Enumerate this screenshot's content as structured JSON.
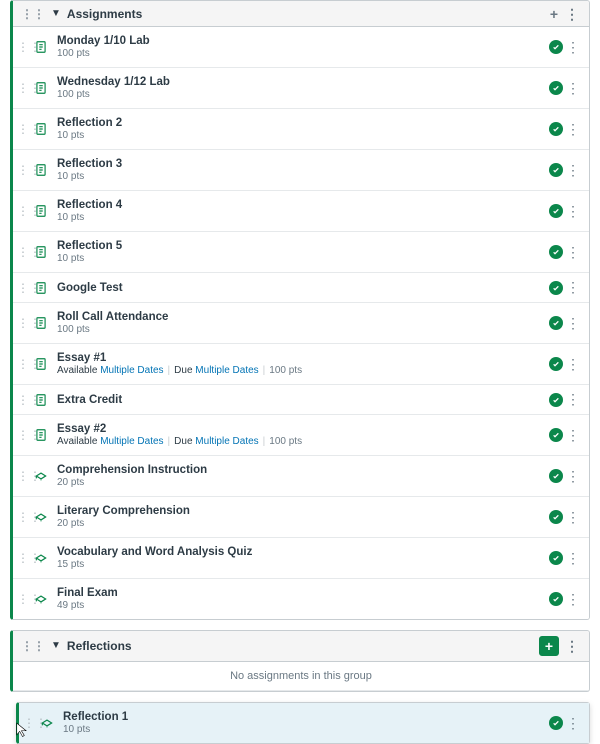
{
  "groups": [
    {
      "title": "Assignments",
      "plus_style": "plain",
      "items": [
        {
          "icon": "assignment",
          "name": "Monday 1/10 Lab",
          "points_text": "100 pts"
        },
        {
          "icon": "assignment",
          "name": "Wednesday 1/12 Lab",
          "points_text": "100 pts"
        },
        {
          "icon": "assignment",
          "name": "Reflection 2",
          "points_text": "10 pts"
        },
        {
          "icon": "assignment",
          "name": "Reflection 3",
          "points_text": "10 pts"
        },
        {
          "icon": "assignment",
          "name": "Reflection 4",
          "points_text": "10 pts"
        },
        {
          "icon": "assignment",
          "name": "Reflection 5",
          "points_text": "10 pts"
        },
        {
          "icon": "assignment",
          "name": "Google Test"
        },
        {
          "icon": "assignment",
          "name": "Roll Call Attendance",
          "points_text": "100 pts"
        },
        {
          "icon": "assignment",
          "name": "Essay #1",
          "avail_label": "Available",
          "avail_link": "Multiple Dates",
          "due_label": "Due",
          "due_link": "Multiple Dates",
          "points_text": "100 pts"
        },
        {
          "icon": "assignment",
          "name": "Extra Credit"
        },
        {
          "icon": "assignment",
          "name": "Essay #2",
          "avail_label": "Available",
          "avail_link": "Multiple Dates",
          "due_label": "Due",
          "due_link": "Multiple Dates",
          "points_text": "100 pts"
        },
        {
          "icon": "quiz",
          "name": "Comprehension Instruction",
          "points_text": "20 pts"
        },
        {
          "icon": "quiz",
          "name": "Literary Comprehension",
          "points_text": "20 pts"
        },
        {
          "icon": "quiz",
          "name": "Vocabulary and Word Analysis Quiz",
          "points_text": "15 pts"
        },
        {
          "icon": "quiz",
          "name": "Final Exam",
          "points_text": "49 pts"
        }
      ]
    },
    {
      "title": "Reflections",
      "plus_style": "active",
      "empty_text": "No assignments in this group",
      "items": []
    }
  ],
  "dragging": {
    "icon": "quiz",
    "name": "Reflection 1",
    "points_text": "10 pts"
  }
}
